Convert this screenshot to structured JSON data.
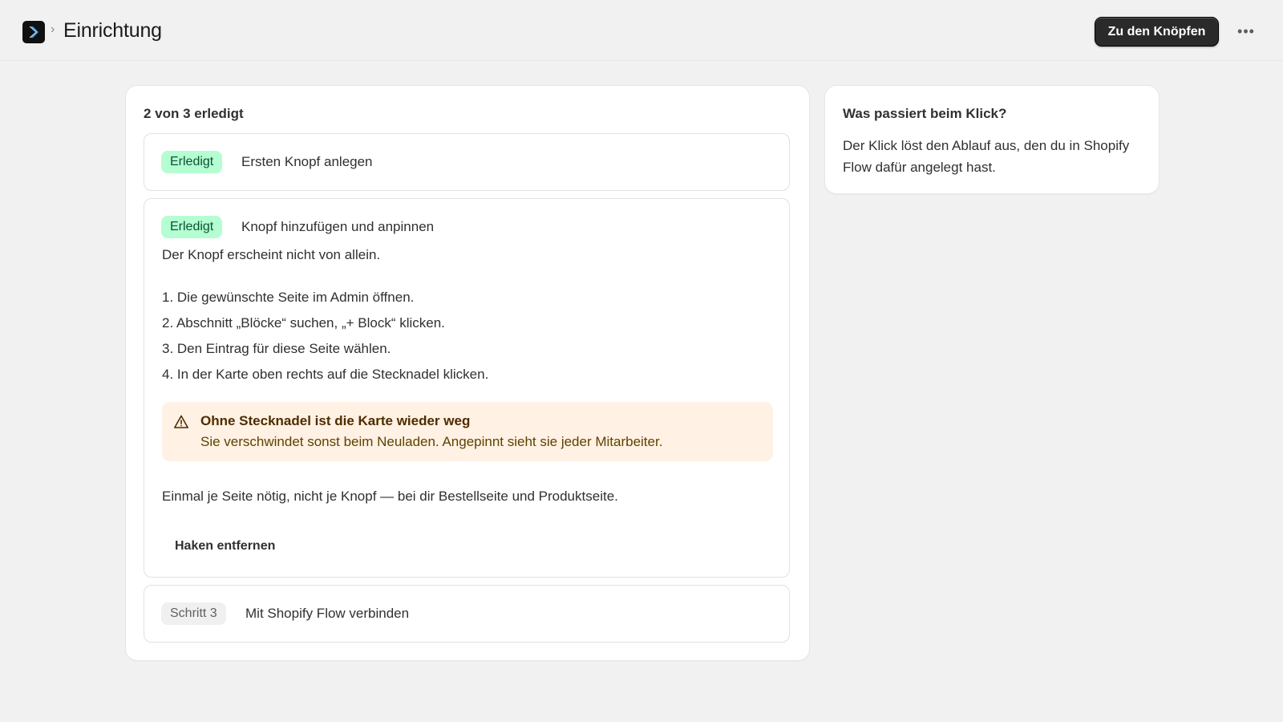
{
  "header": {
    "breadcrumb_separator": "›",
    "title": "Einrichtung",
    "primary_button": "Zu den Knöpfen",
    "more_button": "•••",
    "app_icon": "app-logo-chevron-icon"
  },
  "setup": {
    "progress": "2 von 3 erledigt",
    "steps": [
      {
        "badge": "Erledigt",
        "title": "Ersten Knopf anlegen"
      },
      {
        "badge": "Erledigt",
        "title": "Knopf hinzufügen und anpinnen",
        "intro": "Der Knopf erscheint nicht von allein.",
        "instructions": [
          "1. Die gewünschte Seite im Admin öffnen.",
          "2. Abschnitt „Blöcke“ suchen, „+ Block“ klicken.",
          "3. Den Eintrag für diese Seite wählen.",
          "4. In der Karte oben rechts auf die Stecknadel klicken."
        ],
        "warning": {
          "icon": "warning-icon",
          "title": "Ohne Stecknadel ist die Karte wieder weg",
          "text": "Sie verschwindet sonst beim Neuladen. Angepinnt sieht sie jeder Mitarbeiter."
        },
        "note": "Einmal je Seite nötig, nicht je Knopf — bei dir Bestellseite und Produktseite.",
        "action": "Haken entfernen"
      },
      {
        "badge": "Schritt 3",
        "title": "Mit Shopify Flow verbinden"
      }
    ]
  },
  "info_card": {
    "title": "Was passiert beim Klick?",
    "text": "Der Klick löst den Ablauf aus, den du in Shopify Flow dafür angelegt hast."
  },
  "colors": {
    "done_badge_bg": "#b4fed2",
    "done_badge_text": "#0c5132",
    "warning_bg": "#fff1e3",
    "primary_button_bg": "#2a2a2a"
  }
}
